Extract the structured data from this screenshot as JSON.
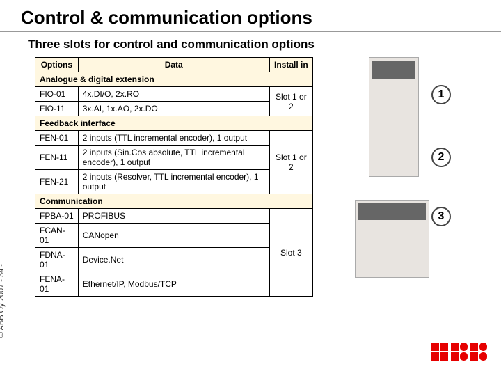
{
  "title": "Control & communication options",
  "subtitle": "Three slots for control and communication options",
  "headers": {
    "options": "Options",
    "data": "Data",
    "install": "Install in"
  },
  "sections": {
    "s1": "Analogue & digital extension",
    "s2": "Feedback interface",
    "s3": "Communication"
  },
  "rows": {
    "r1": {
      "opt": "FIO-01",
      "data": "4x.DI/O, 2x.RO"
    },
    "r2": {
      "opt": "FIO-11",
      "data": "3x.AI, 1x.AO, 2x.DO"
    },
    "r3": {
      "opt": "FEN-01",
      "data": "2 inputs (TTL incremental encoder), 1 output"
    },
    "r4": {
      "opt": "FEN-11",
      "data": "2 inputs (Sin.Cos absolute, TTL incremental encoder), 1 output"
    },
    "r5": {
      "opt": "FEN-21",
      "data": "2 inputs (Resolver, TTL incremental encoder), 1 output"
    },
    "r6": {
      "opt": "FPBA-01",
      "data": "PROFIBUS"
    },
    "r7": {
      "opt": "FCAN-01",
      "data": "CANopen"
    },
    "r8": {
      "opt": "FDNA-01",
      "data": "Device.Net"
    },
    "r9": {
      "opt": "FENA-01",
      "data": "Ethernet/IP, Modbus/TCP"
    }
  },
  "install": {
    "g1": "Slot 1 or 2",
    "g2": "Slot 1 or 2",
    "g3": "Slot 3"
  },
  "callouts": {
    "c1": "1",
    "c2": "2",
    "c3": "3"
  },
  "copyright": "© ABB Oy 2007  - 34 -",
  "logo": "ABB"
}
